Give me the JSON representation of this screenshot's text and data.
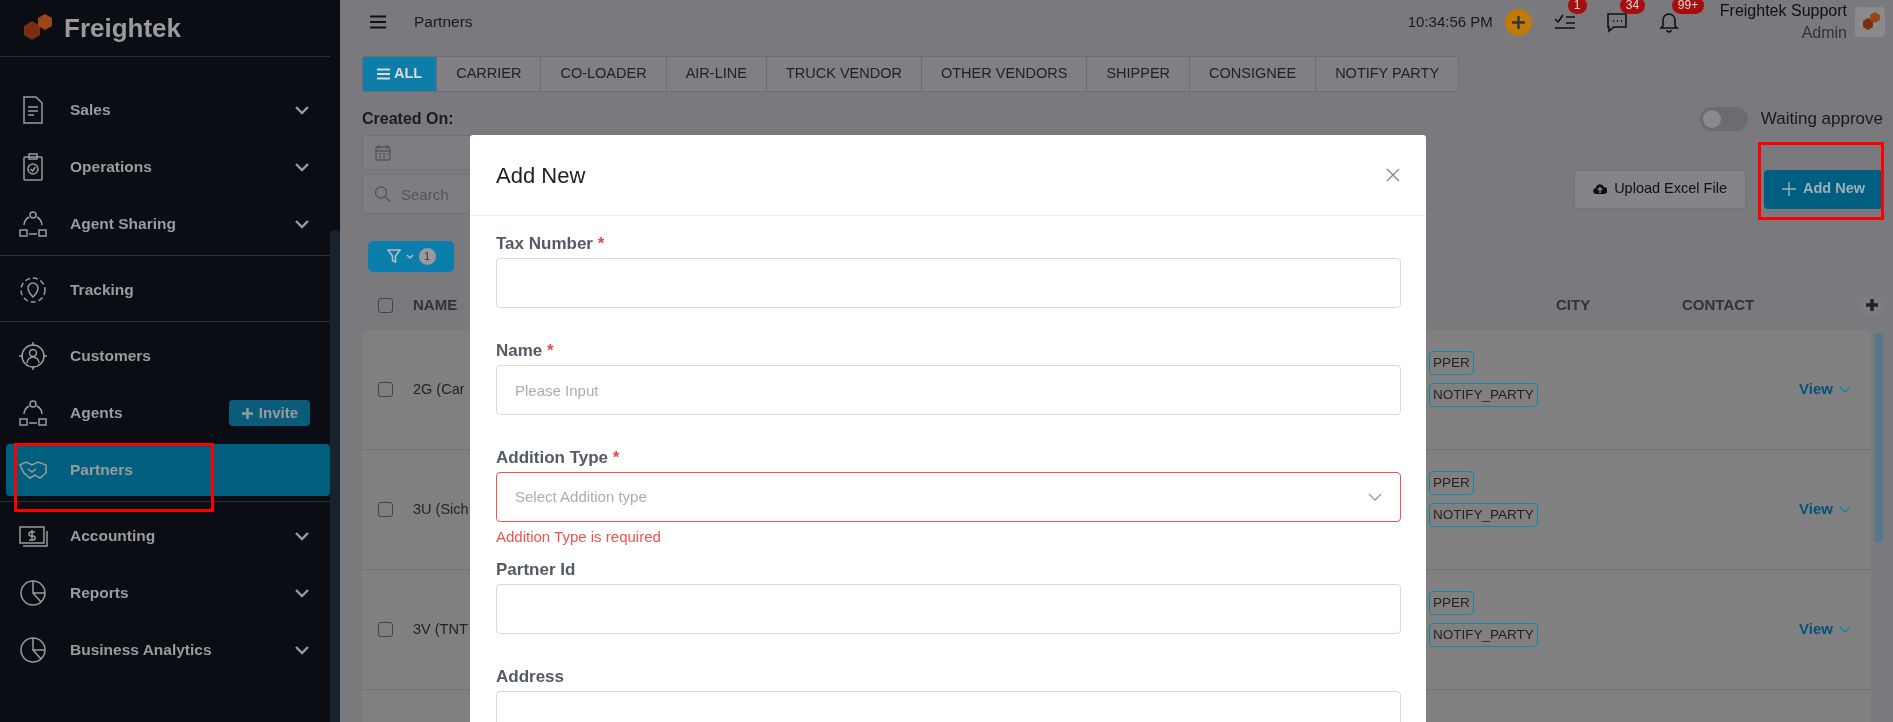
{
  "app": {
    "logo_text": "Freightek"
  },
  "sidebar": {
    "sections": [
      {
        "items": [
          {
            "label": "Sales",
            "expandable": true,
            "selected": false,
            "highlighted": false
          },
          {
            "label": "Operations",
            "expandable": true,
            "selected": false,
            "highlighted": false
          },
          {
            "label": "Agent Sharing",
            "expandable": true,
            "selected": false,
            "highlighted": false
          }
        ]
      },
      {
        "items": [
          {
            "label": "Tracking",
            "expandable": false,
            "selected": false,
            "highlighted": false
          }
        ]
      },
      {
        "items": [
          {
            "label": "Customers",
            "expandable": false,
            "selected": false,
            "highlighted": false
          },
          {
            "label": "Agents",
            "expandable": false,
            "selected": false,
            "highlighted": false,
            "action": "Invite"
          },
          {
            "label": "Partners",
            "expandable": false,
            "selected": true,
            "highlighted": true
          }
        ]
      },
      {
        "items": [
          {
            "label": "Accounting",
            "expandable": true,
            "selected": false,
            "highlighted": false
          },
          {
            "label": "Reports",
            "expandable": true,
            "selected": false,
            "highlighted": false
          },
          {
            "label": "Business Analytics",
            "expandable": true,
            "selected": false,
            "highlighted": false
          }
        ]
      }
    ]
  },
  "topbar": {
    "title": "Partners",
    "time": "10:34:56 PM",
    "badges": [
      "1",
      "34",
      "99+"
    ],
    "user": {
      "name": "Freightek Support",
      "role": "Admin"
    }
  },
  "tabs": [
    {
      "label": "ALL",
      "selected": true
    },
    {
      "label": "CARRIER",
      "selected": false
    },
    {
      "label": "CO-LOADER",
      "selected": false
    },
    {
      "label": "AIR-LINE",
      "selected": false
    },
    {
      "label": "TRUCK VENDOR",
      "selected": false
    },
    {
      "label": "OTHER VENDORS",
      "selected": false
    },
    {
      "label": "SHIPPER",
      "selected": false
    },
    {
      "label": "CONSIGNEE",
      "selected": false
    },
    {
      "label": "NOTIFY PARTY",
      "selected": false
    }
  ],
  "filters": {
    "created_on_label": "Created On:",
    "search_placeholder": "Search",
    "filter_count": "1",
    "waiting_toggle": {
      "label": "Waiting approve",
      "on": false
    }
  },
  "actions": [
    {
      "label": "Upload Excel File",
      "kind": "upload",
      "highlighted": false
    },
    {
      "label": "Add New",
      "kind": "add",
      "highlighted": true
    }
  ],
  "table": {
    "select_all_checked": false,
    "columns": [
      "NAME",
      "CITY",
      "CONTACT"
    ],
    "rows": [
      {
        "name": "2G (Car",
        "tags": [
          "PPER",
          "NOTIFY_PARTY"
        ],
        "action": "View",
        "checked": false
      },
      {
        "name": "3U (Sich",
        "tags": [
          "PPER",
          "NOTIFY_PARTY"
        ],
        "action": "View",
        "checked": false
      },
      {
        "name": "3V (TNT",
        "tags": [
          "PPER",
          "NOTIFY_PARTY"
        ],
        "action": "View",
        "checked": false
      }
    ]
  },
  "modal": {
    "title": "Add New",
    "required_mark": "*",
    "fields": [
      {
        "kind": "text",
        "label": "Tax Number",
        "required": true
      },
      {
        "kind": "text",
        "label": "Name",
        "required": true,
        "placeholder": "Please Input"
      },
      {
        "kind": "select",
        "label": "Addition Type",
        "required": true,
        "placeholder": "Select Addition type",
        "error": "Addition Type is required"
      },
      {
        "kind": "text",
        "label": "Partner Id",
        "required": false
      },
      {
        "kind": "text",
        "label": "Address",
        "required": false
      }
    ]
  }
}
